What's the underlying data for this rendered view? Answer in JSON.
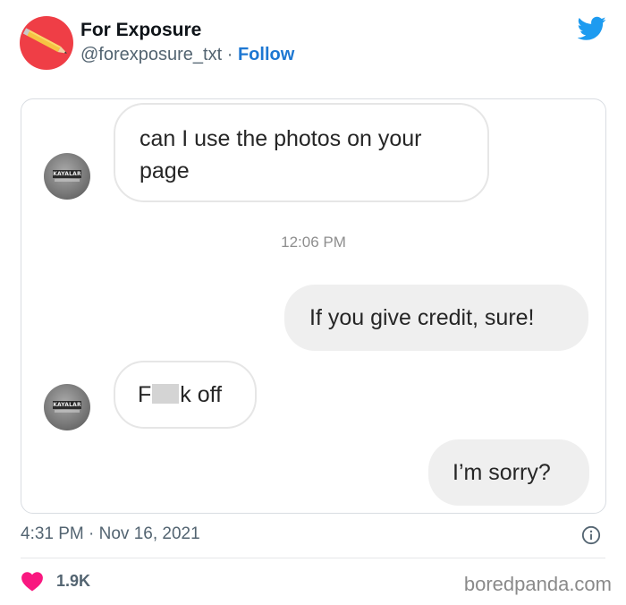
{
  "account": {
    "display_name": "For Exposure",
    "handle": "@forexposure_txt",
    "separator": "·",
    "follow_label": "Follow",
    "avatar_icon": "pencil-on-red-avatar",
    "platform_icon": "twitter-bird-icon",
    "brand_color": "#1d9bf0"
  },
  "dm": {
    "messages": [
      {
        "direction": "incoming",
        "lines": [
          "can I use the photos on your",
          "page"
        ]
      },
      {
        "direction": "outgoing",
        "text": "If you give credit, sure!"
      },
      {
        "direction": "incoming",
        "text_start": "F",
        "text_end": "k off",
        "censored": true
      },
      {
        "direction": "outgoing",
        "text": "I’m sorry?"
      }
    ],
    "time_divider": "12:06 PM",
    "sender_avatar_text": "KAYALAR"
  },
  "footer": {
    "timestamp": "4:31 PM · Nov 16, 2021",
    "likes": "1.9K",
    "like_color": "#f91880",
    "watermark": "boredpanda.com",
    "info_icon": "info-icon"
  }
}
